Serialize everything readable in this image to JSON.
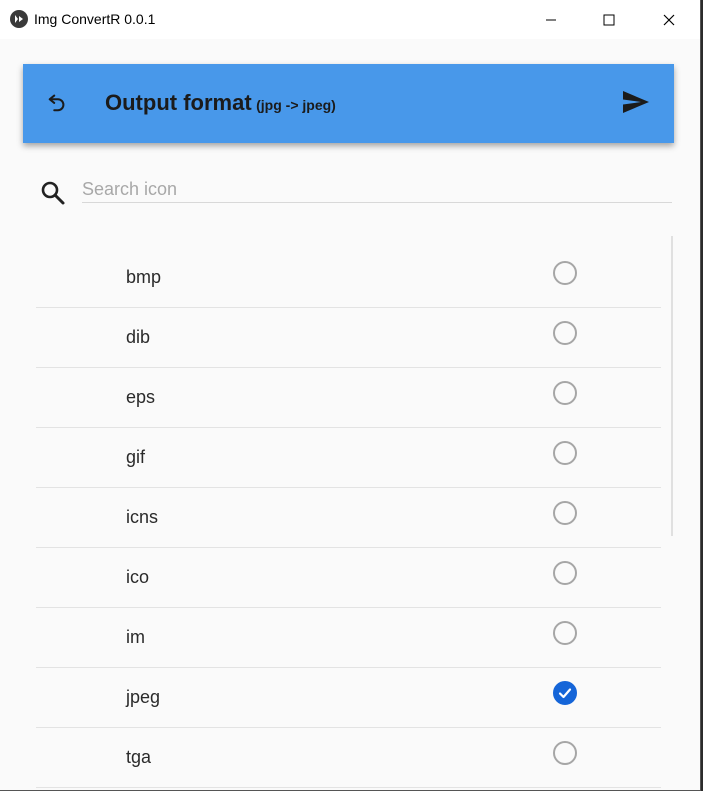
{
  "window": {
    "title": "Img ConvertR 0.0.1"
  },
  "appbar": {
    "title": "Output format",
    "subtitle": "(jpg -> jpeg)",
    "background": "#4898ea"
  },
  "search": {
    "placeholder": "Search icon",
    "value": ""
  },
  "formats": [
    {
      "label": "bmp",
      "checked": false
    },
    {
      "label": "dib",
      "checked": false
    },
    {
      "label": "eps",
      "checked": false
    },
    {
      "label": "gif",
      "checked": false
    },
    {
      "label": "icns",
      "checked": false
    },
    {
      "label": "ico",
      "checked": false
    },
    {
      "label": "im",
      "checked": false
    },
    {
      "label": "jpeg",
      "checked": true
    },
    {
      "label": "tga",
      "checked": false
    }
  ],
  "icons": {
    "app": "kivy-logo-icon",
    "minimize": "minimize-icon",
    "maximize": "maximize-icon",
    "close": "close-icon",
    "back": "undo-arrow-icon",
    "send": "send-icon",
    "search": "search-icon",
    "radio": "radio-unchecked-icon",
    "radio_checked": "radio-checked-icon"
  },
  "colors": {
    "accent": "#1565d8",
    "radio_off": "#a6a6a6"
  }
}
